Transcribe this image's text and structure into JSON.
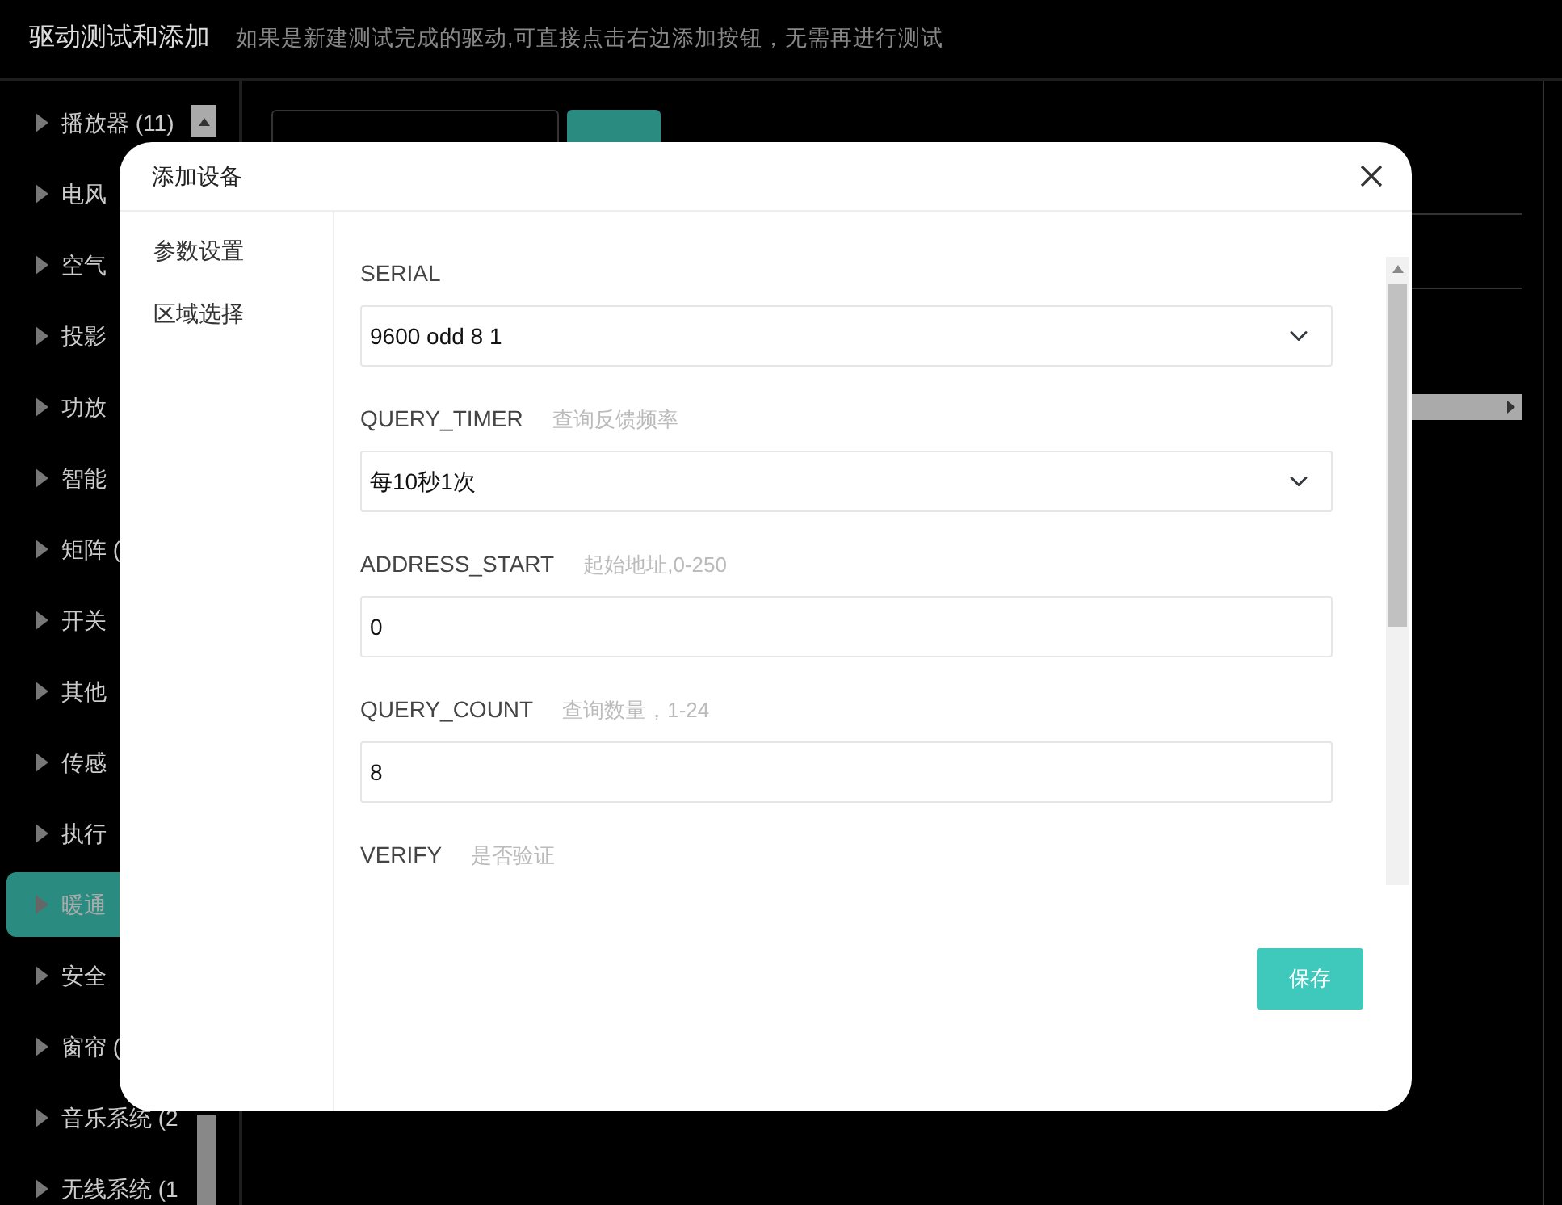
{
  "header": {
    "title": "驱动测试和添加",
    "subtitle": "如果是新建测试完成的驱动,可直接点击右边添加按钮，无需再进行测试"
  },
  "categories": [
    {
      "label": "播放器 (11)",
      "selected": false
    },
    {
      "label": "电风",
      "selected": false
    },
    {
      "label": "空气",
      "selected": false
    },
    {
      "label": "投影",
      "selected": false
    },
    {
      "label": "功放",
      "selected": false
    },
    {
      "label": "智能",
      "selected": false
    },
    {
      "label": "矩阵 (",
      "selected": false
    },
    {
      "label": "开关",
      "selected": false
    },
    {
      "label": "其他",
      "selected": false
    },
    {
      "label": "传感",
      "selected": false
    },
    {
      "label": "执行",
      "selected": false
    },
    {
      "label": "暖通",
      "selected": true
    },
    {
      "label": "安全",
      "selected": false
    },
    {
      "label": "窗帘 (",
      "selected": false
    },
    {
      "label": "音乐系统 (2",
      "selected": false
    },
    {
      "label": "无线系统 (1",
      "selected": false
    }
  ],
  "dialog": {
    "title": "添加设备",
    "nav": [
      "参数设置",
      "区域选择"
    ],
    "fields": [
      {
        "kind": "select",
        "label": "SERIAL",
        "value": "9600 odd 8 1"
      },
      {
        "kind": "select",
        "label": "QUERY_TIMER",
        "hint": "查询反馈频率",
        "value": "每10秒1次"
      },
      {
        "kind": "input",
        "label": "ADDRESS_START",
        "hint": "起始地址,0-250",
        "value": "0"
      },
      {
        "kind": "input",
        "label": "QUERY_COUNT",
        "hint": "查询数量，1-24",
        "value": "8"
      },
      {
        "kind": "label",
        "label": "VERIFY",
        "hint": "是否验证"
      }
    ],
    "save": "保存"
  }
}
